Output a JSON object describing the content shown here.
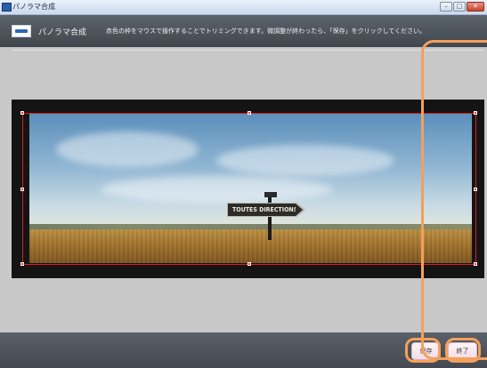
{
  "window": {
    "title": "パノラマ合成"
  },
  "header": {
    "title": "パノラマ合成",
    "instruction": "赤色の枠をマウスで操作することでトリミングできます。微調整が終わったら、「保存」をクリックしてください。"
  },
  "panorama": {
    "sign_text": "TOUTES DIRECTIONS"
  },
  "footer": {
    "save_label": "保存",
    "finish_label": "終了"
  },
  "colors": {
    "crop_frame": "#d81f1f",
    "callout": "#f4a05a",
    "header_bg": "#4a5158"
  },
  "icons": {
    "app": "app-icon",
    "header_logo": "panorama-logo-icon"
  }
}
